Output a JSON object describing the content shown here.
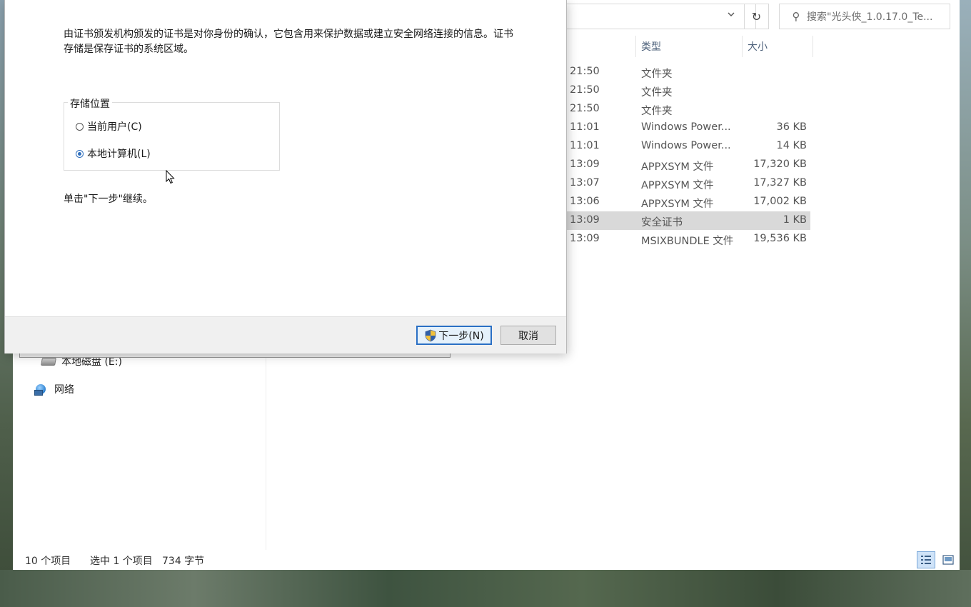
{
  "explorer": {
    "address_dropdown_icon": "chevron-down-icon",
    "refresh_icon": "refresh-icon",
    "search": {
      "icon": "search-icon",
      "placeholder": "搜索\"光头侠_1.0.17.0_Te..."
    },
    "columns": {
      "type": "类型",
      "size": "大小"
    },
    "files": [
      {
        "date": "21:50",
        "type": "文件夹",
        "size": ""
      },
      {
        "date": "21:50",
        "type": "文件夹",
        "size": ""
      },
      {
        "date": "21:50",
        "type": "文件夹",
        "size": ""
      },
      {
        "date": "11:01",
        "type": "Windows Power...",
        "size": "36 KB"
      },
      {
        "date": "11:01",
        "type": "Windows Power...",
        "size": "14 KB"
      },
      {
        "date": "13:09",
        "type": "APPXSYM 文件",
        "size": "17,320 KB"
      },
      {
        "date": "13:07",
        "type": "APPXSYM 文件",
        "size": "17,327 KB"
      },
      {
        "date": "13:06",
        "type": "APPXSYM 文件",
        "size": "17,002 KB"
      },
      {
        "date": "13:09",
        "type": "安全证书",
        "size": "1 KB",
        "selected": true
      },
      {
        "date": "13:09",
        "type": "MSIXBUNDLE 文件",
        "size": "19,536 KB"
      }
    ],
    "nav": {
      "drive_e": "本地磁盘 (E:)",
      "network": "网络"
    },
    "status": {
      "item_count": "10 个项目",
      "selection": "选中 1 个项目",
      "size": "734 字节"
    }
  },
  "wizard": {
    "intro_text": "由证书颁发机构颁发的证书是对你身份的确认，它包含用来保护数据或建立安全网络连接的信息。证书存储是保存证书的系统区域。",
    "store_location_label": "存储位置",
    "options": [
      {
        "label": "当前用户(C)",
        "checked": false
      },
      {
        "label": "本地计算机(L)",
        "checked": true
      }
    ],
    "continue_text": "单击\"下一步\"继续。",
    "next_button": "下一步(N)",
    "cancel_button": "取消",
    "shield_icon": "uac-shield-icon"
  }
}
